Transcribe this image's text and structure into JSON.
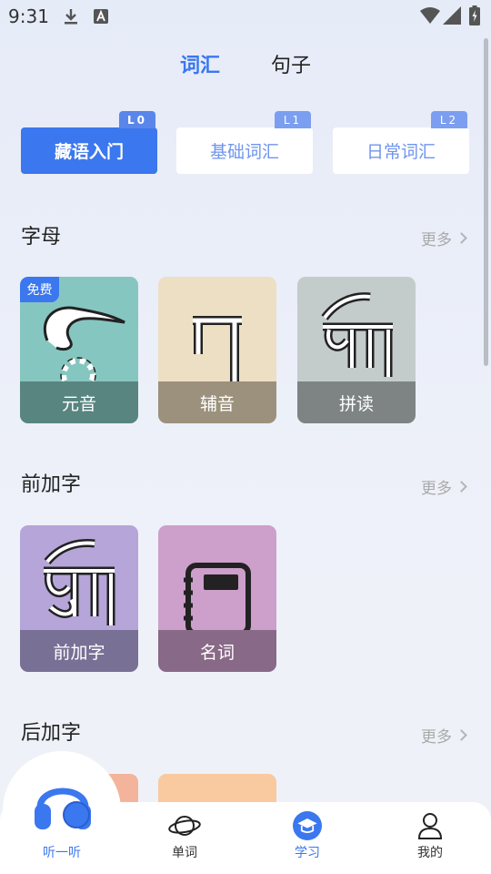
{
  "status_bar": {
    "time": "9:31"
  },
  "top_tabs": [
    {
      "label": "词汇"
    },
    {
      "label": "句子"
    }
  ],
  "levels": [
    {
      "label": "藏语入门",
      "badge": "L0"
    },
    {
      "label": "基础词汇",
      "badge": "L1"
    },
    {
      "label": "日常词汇",
      "badge": "L2"
    }
  ],
  "sections": [
    {
      "title": "字母",
      "more": "更多",
      "cards": [
        {
          "label": "元音",
          "free": "免费"
        },
        {
          "label": "辅音"
        },
        {
          "label": "拼读"
        }
      ]
    },
    {
      "title": "前加字",
      "more": "更多",
      "cards": [
        {
          "label": "前加字"
        },
        {
          "label": "名词"
        }
      ]
    },
    {
      "title": "后加字",
      "more": "更多"
    }
  ],
  "bottom_nav": {
    "listen": "听一听",
    "items": [
      {
        "label": "单词"
      },
      {
        "label": "学习"
      },
      {
        "label": "我的"
      }
    ]
  },
  "colors": {
    "accent": "#3b77ee",
    "vowel": "#86c6c0",
    "consonant": "#ecdfc3",
    "spell": "#c4cbcb",
    "prefix": "#b6a5d8",
    "noun": "#cd9fcb"
  }
}
